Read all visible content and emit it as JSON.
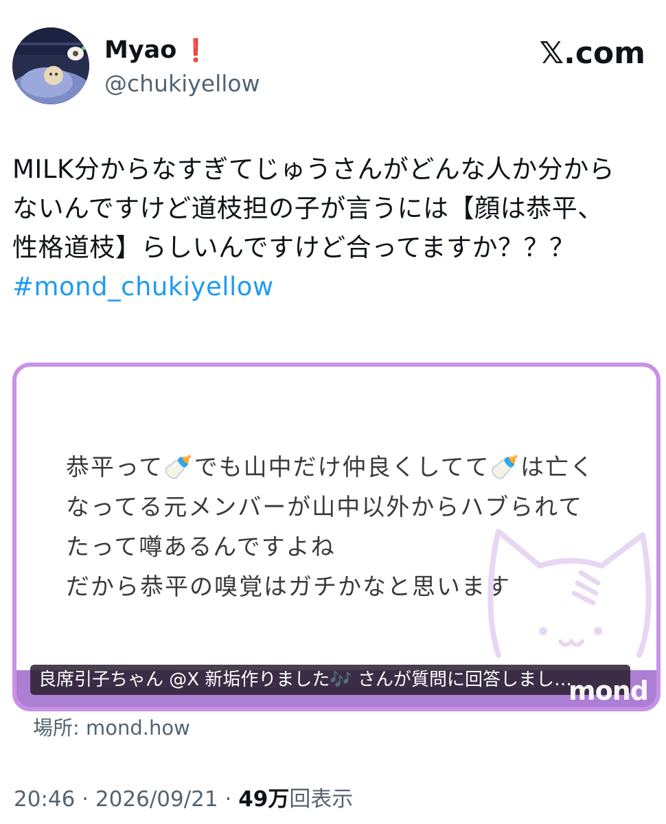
{
  "author": {
    "name": "Myao",
    "name_emoji": "❗",
    "handle": "@chukiyellow"
  },
  "brand": {
    "x_logo": "𝕏",
    "suffix": ".com"
  },
  "tweet": {
    "lines": [
      "MILK分からなすぎてじゅうさんがどんな人か分から",
      "ないんですけど道枝担の子が言うには【顔は恭平、",
      "性格道枝】らしいんですけど合ってますか？？？"
    ],
    "hashtag": "#mond_chukiyellow"
  },
  "card": {
    "answer_lines": [
      "恭平って🍼でも山中だけ仲良くしてて🍼は亡く",
      "なってる元メンバーが山中以外からハブられて",
      "たって噂あるんですよね",
      "だから恭平の嗅覚はガチかなと思います"
    ],
    "caption": "良席引子ちゃん @X 新垢作りました🎶 さんが質問に回答しまし…",
    "logo": "mond",
    "accent_color": "#c891e6"
  },
  "location": {
    "label": "場所:",
    "value": "mond.how"
  },
  "meta": {
    "time": "20:46",
    "separator": "·",
    "date": "2026/09/21",
    "views_count": "49万",
    "views_label": "回表示"
  }
}
